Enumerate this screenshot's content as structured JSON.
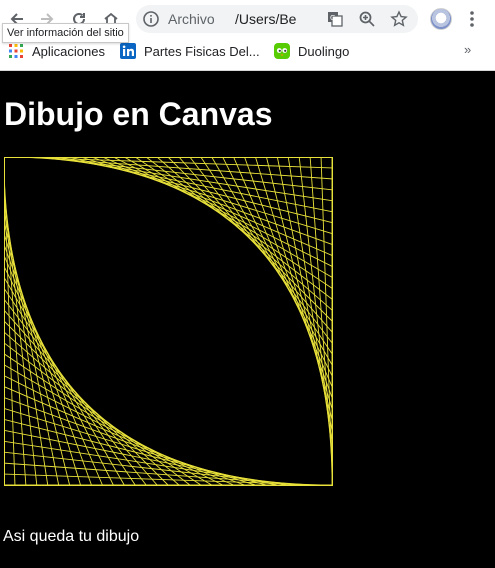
{
  "browser": {
    "omnibox": {
      "scheme_label": "Archivo",
      "url": "/Users/Be"
    },
    "tooltip": "Ver información del sitio",
    "bookmarks": [
      {
        "label": "Aplicaciones",
        "icon": "apps-grid-icon"
      },
      {
        "label": "Partes Fisicas Del...",
        "icon": "linkedin-icon"
      },
      {
        "label": "Duolingo",
        "icon": "duolingo-icon"
      }
    ],
    "more_label": "»"
  },
  "page": {
    "title": "Dibujo en Canvas",
    "caption": "Asi queda tu dibujo"
  },
  "drawing": {
    "line_color": "#e8e13a",
    "border_color": "#e8e13a",
    "line_count": 30
  }
}
